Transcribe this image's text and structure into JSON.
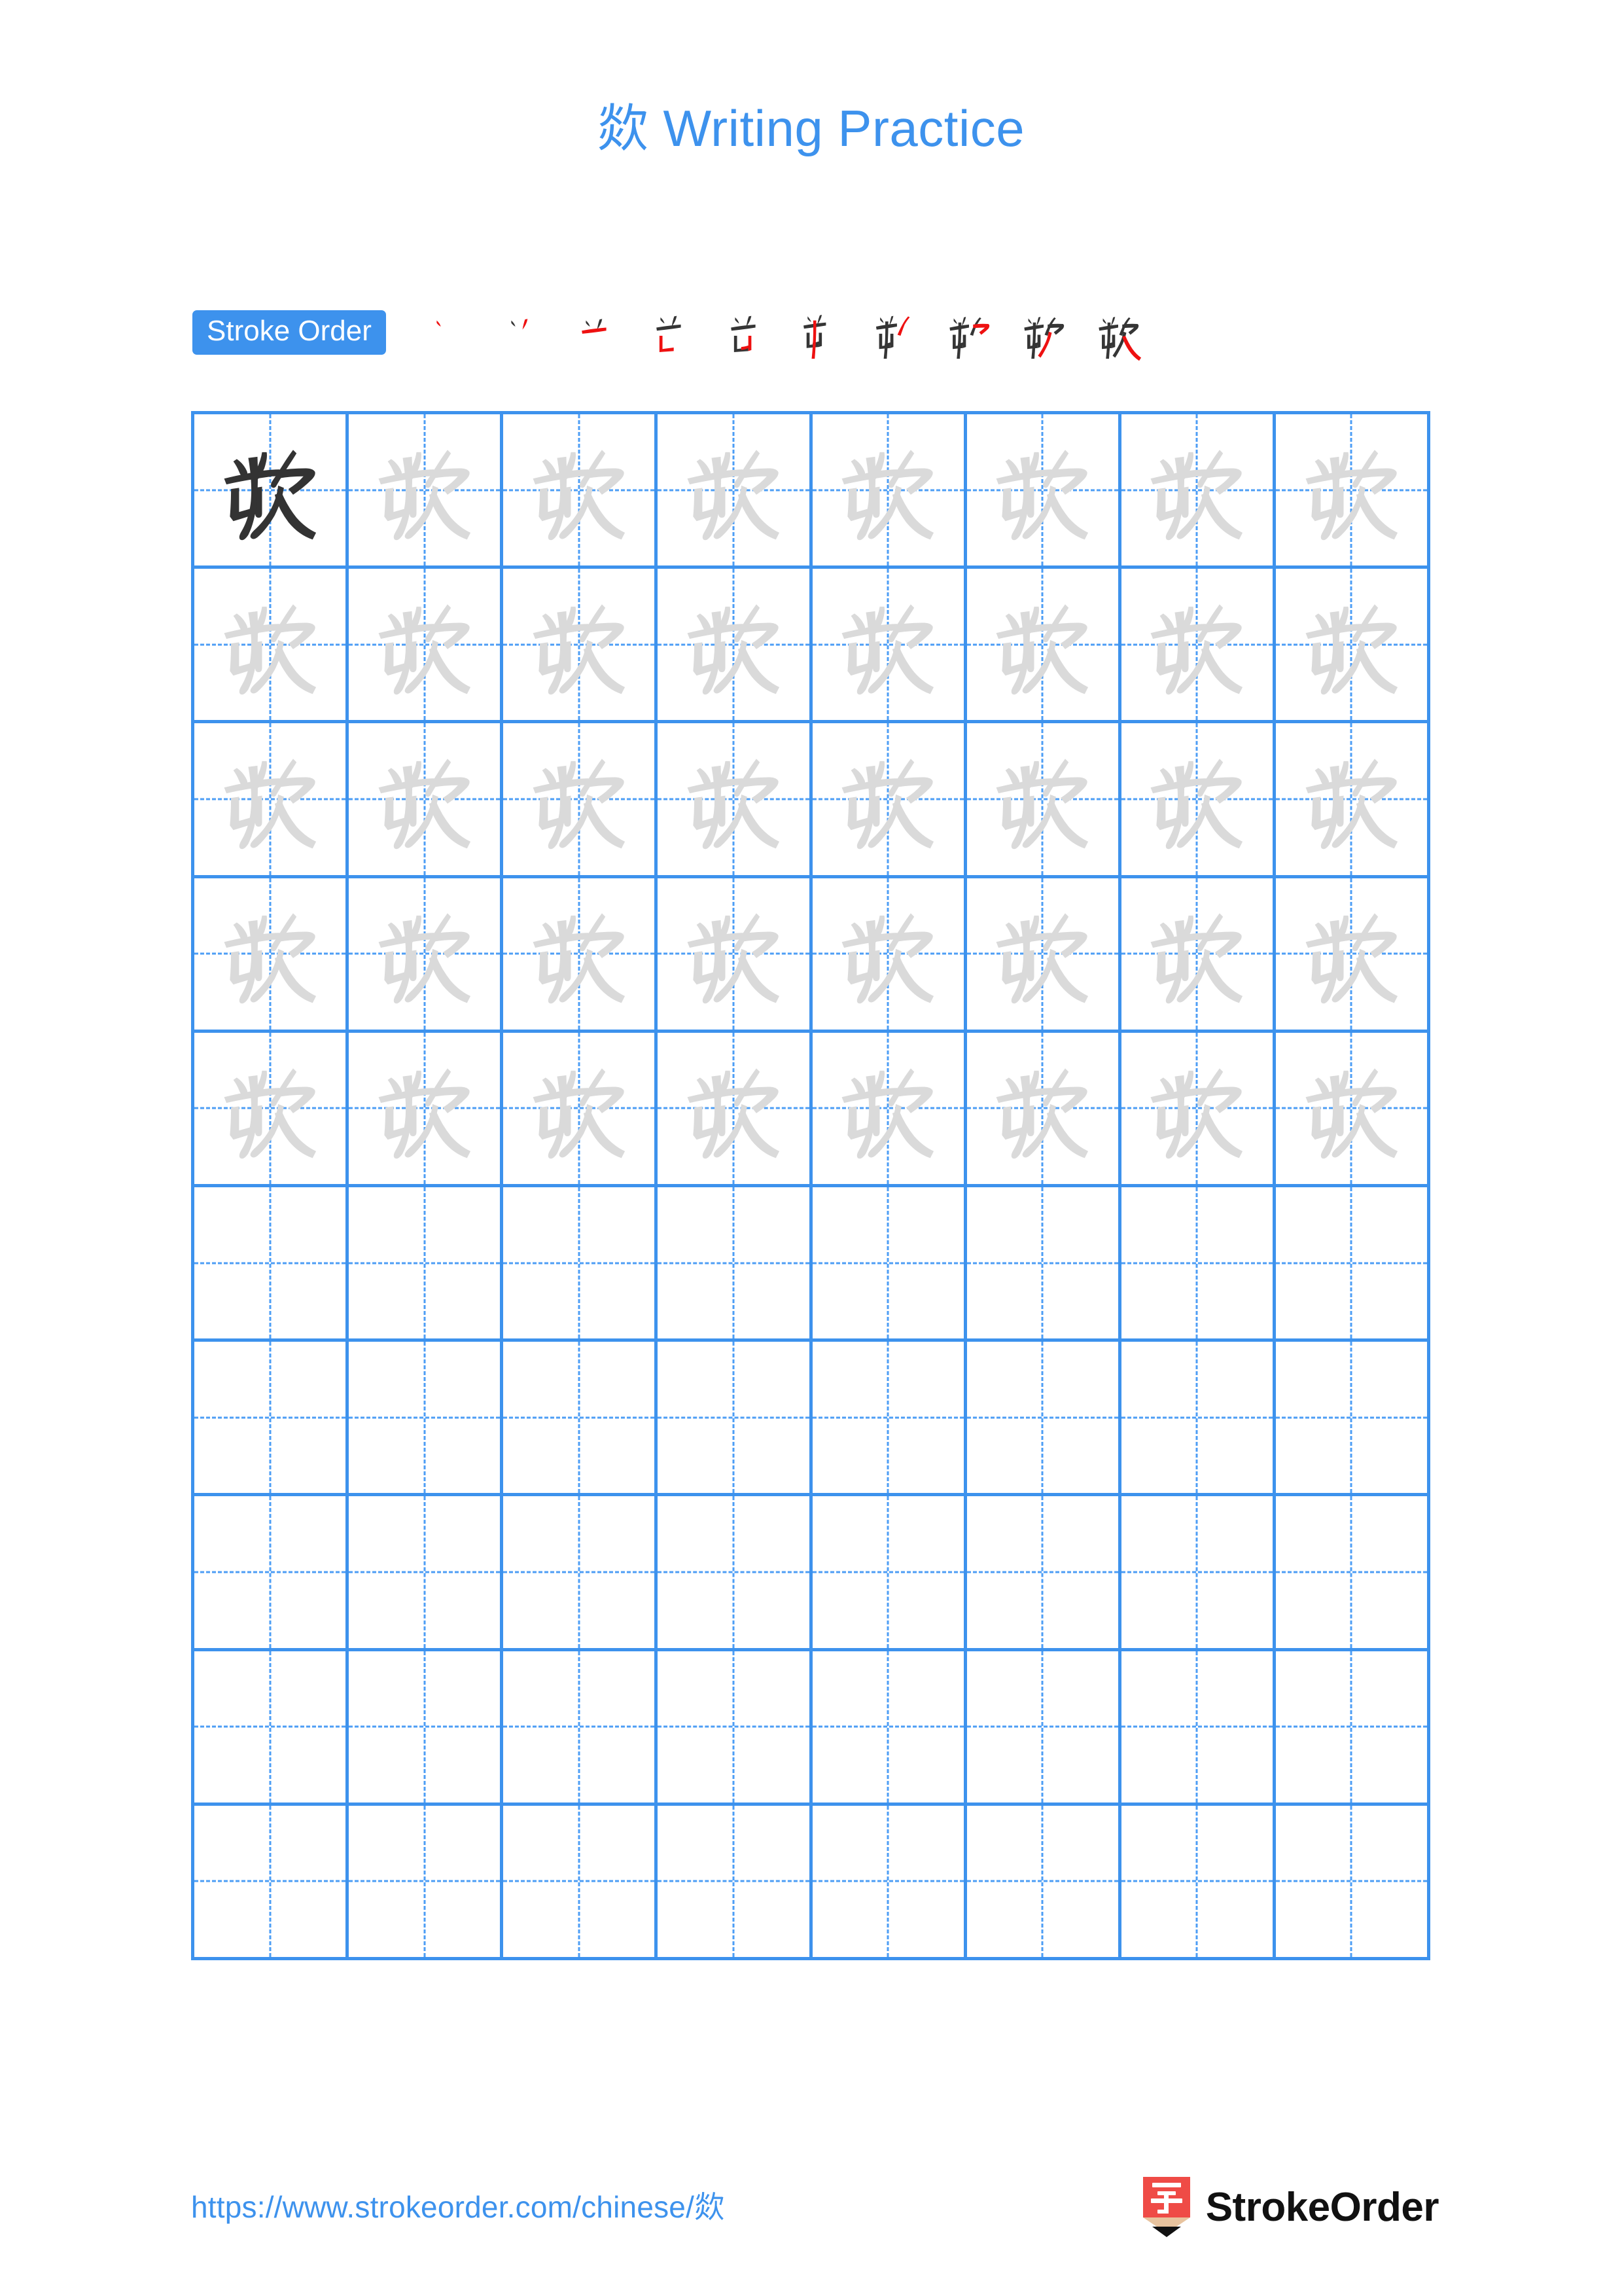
{
  "document": {
    "character": "欻",
    "title": "欻 Writing Practice",
    "background_color": "#ffffff"
  },
  "header": {
    "title": "欻 Writing Practice",
    "title_color": "#3d92ed"
  },
  "stroke_order": {
    "badge_label": "Stroke Order",
    "badge_bg_color": "#3d92ed",
    "badge_text_color": "#ffffff",
    "stroke_count": 10,
    "existing_stroke_color": "#353535",
    "new_stroke_color": "#ee1111",
    "steps": [
      {
        "step": 1,
        "name": "stroke-step-1",
        "new_stroke": "dot"
      },
      {
        "step": 2,
        "name": "stroke-step-2",
        "new_stroke": "left-falling-dot"
      },
      {
        "step": 3,
        "name": "stroke-step-3",
        "new_stroke": "horizontal"
      },
      {
        "step": 4,
        "name": "stroke-step-4",
        "new_stroke": "left-vertical-turn"
      },
      {
        "step": 5,
        "name": "stroke-step-5",
        "new_stroke": "horizontal-hook"
      },
      {
        "step": 6,
        "name": "stroke-step-6",
        "new_stroke": "long-vertical"
      },
      {
        "step": 7,
        "name": "stroke-step-7",
        "new_stroke": "right-falling"
      },
      {
        "step": 8,
        "name": "stroke-step-8",
        "new_stroke": "horizontal-bend"
      },
      {
        "step": 9,
        "name": "stroke-step-9",
        "new_stroke": "left-falling"
      },
      {
        "step": 10,
        "name": "stroke-step-10",
        "new_stroke": "right-falling-press"
      }
    ]
  },
  "practice_grid": {
    "rows": 10,
    "columns": 8,
    "filled_rows": 5,
    "empty_rows": 5,
    "grid_line_color": "#3d92ed",
    "guide_line_color": "#4d9ef5",
    "model_character_color": "#333333",
    "trace_character_color": "#dadada",
    "cells": [
      [
        "model",
        "trace",
        "trace",
        "trace",
        "trace",
        "trace",
        "trace",
        "trace"
      ],
      [
        "trace",
        "trace",
        "trace",
        "trace",
        "trace",
        "trace",
        "trace",
        "trace"
      ],
      [
        "trace",
        "trace",
        "trace",
        "trace",
        "trace",
        "trace",
        "trace",
        "trace"
      ],
      [
        "trace",
        "trace",
        "trace",
        "trace",
        "trace",
        "trace",
        "trace",
        "trace"
      ],
      [
        "trace",
        "trace",
        "trace",
        "trace",
        "trace",
        "trace",
        "trace",
        "trace"
      ],
      [
        "empty",
        "empty",
        "empty",
        "empty",
        "empty",
        "empty",
        "empty",
        "empty"
      ],
      [
        "empty",
        "empty",
        "empty",
        "empty",
        "empty",
        "empty",
        "empty",
        "empty"
      ],
      [
        "empty",
        "empty",
        "empty",
        "empty",
        "empty",
        "empty",
        "empty",
        "empty"
      ],
      [
        "empty",
        "empty",
        "empty",
        "empty",
        "empty",
        "empty",
        "empty",
        "empty"
      ],
      [
        "empty",
        "empty",
        "empty",
        "empty",
        "empty",
        "empty",
        "empty",
        "empty"
      ]
    ]
  },
  "footer": {
    "url": "https://www.strokeorder.com/chinese/欻",
    "url_color": "#3d92ed",
    "brand_name": "StrokeOrder",
    "brand_mark_character": "字",
    "brand_mark_color": "#ef4b46",
    "brand_mark_tip_color": "#e8c39e",
    "brand_text_color": "#111111"
  }
}
